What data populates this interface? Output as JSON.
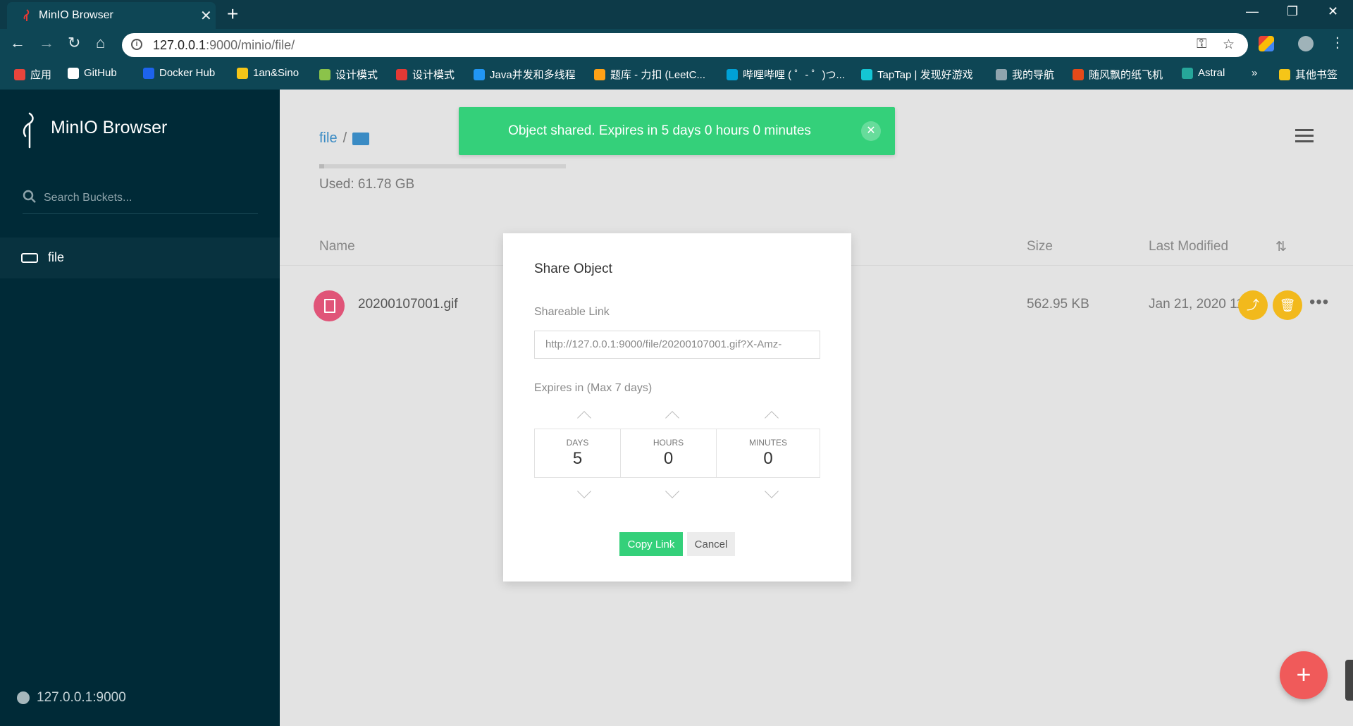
{
  "browser": {
    "tab_title": "MinIO Browser",
    "tab_close": "✕",
    "new_tab": "+",
    "url_host": "127.0.0.1",
    "url_rest": ":9000/minio/file/",
    "window_controls": [
      "—",
      "❐",
      "✕"
    ],
    "bookmarks": [
      {
        "label": "应用",
        "color": "#e8453c"
      },
      {
        "label": "GitHub",
        "color": "#ffffff"
      },
      {
        "label": "Docker Hub",
        "color": "#1d63ed"
      },
      {
        "label": "1an&Sino",
        "color": "#f5c518"
      },
      {
        "label": "设计模式",
        "color": "#8bc34a"
      },
      {
        "label": "设计模式",
        "color": "#e53935"
      },
      {
        "label": "Java并发和多线程",
        "color": "#2196f3"
      },
      {
        "label": "题库 - 力扣 (LeetC...",
        "color": "#ffa116"
      },
      {
        "label": "哔哩哔哩 ( ゜- ゜)つ...",
        "color": "#00a1d6"
      },
      {
        "label": "TapTap | 发现好游戏",
        "color": "#14c6d4"
      },
      {
        "label": "我的导航",
        "color": "#90a4ae"
      },
      {
        "label": "随风飘的纸飞机",
        "color": "#e64a19"
      },
      {
        "label": "Astral",
        "color": "#26a69a"
      }
    ],
    "bookmarks_overflow": "»",
    "other_bookmarks": "其他书签"
  },
  "sidebar": {
    "brand": "MinIO Browser",
    "search_placeholder": "Search Buckets...",
    "buckets": [
      {
        "name": "file"
      }
    ],
    "host": "127.0.0.1:9000"
  },
  "main": {
    "breadcrumb": "file",
    "breadcrumb_sep": "/",
    "usage_fraction": 0.02,
    "used_text": "Used: 61.78 GB",
    "columns": {
      "name": "Name",
      "size": "Size",
      "modified": "Last Modified",
      "sort_icon": "⇅"
    },
    "files": [
      {
        "name": "20200107001.gif",
        "size": "562.95 KB",
        "modified": "Jan 21, 2020 11:"
      }
    ],
    "more_label": "•••",
    "fab_label": "+"
  },
  "toast": {
    "message": "Object shared. Expires in 5 days 0 hours 0 minutes",
    "close": "✕",
    "color": "#34d07a"
  },
  "modal": {
    "title": "Share Object",
    "link_label": "Shareable Link",
    "link_value": "http://127.0.0.1:9000/file/20200107001.gif?X-Amz-",
    "expires_label": "Expires in (Max 7 days)",
    "days_caption": "DAYS",
    "days_value": "5",
    "hours_caption": "HOURS",
    "hours_value": "0",
    "minutes_caption": "MINUTES",
    "minutes_value": "0",
    "copy_label": "Copy Link",
    "cancel_label": "Cancel"
  }
}
